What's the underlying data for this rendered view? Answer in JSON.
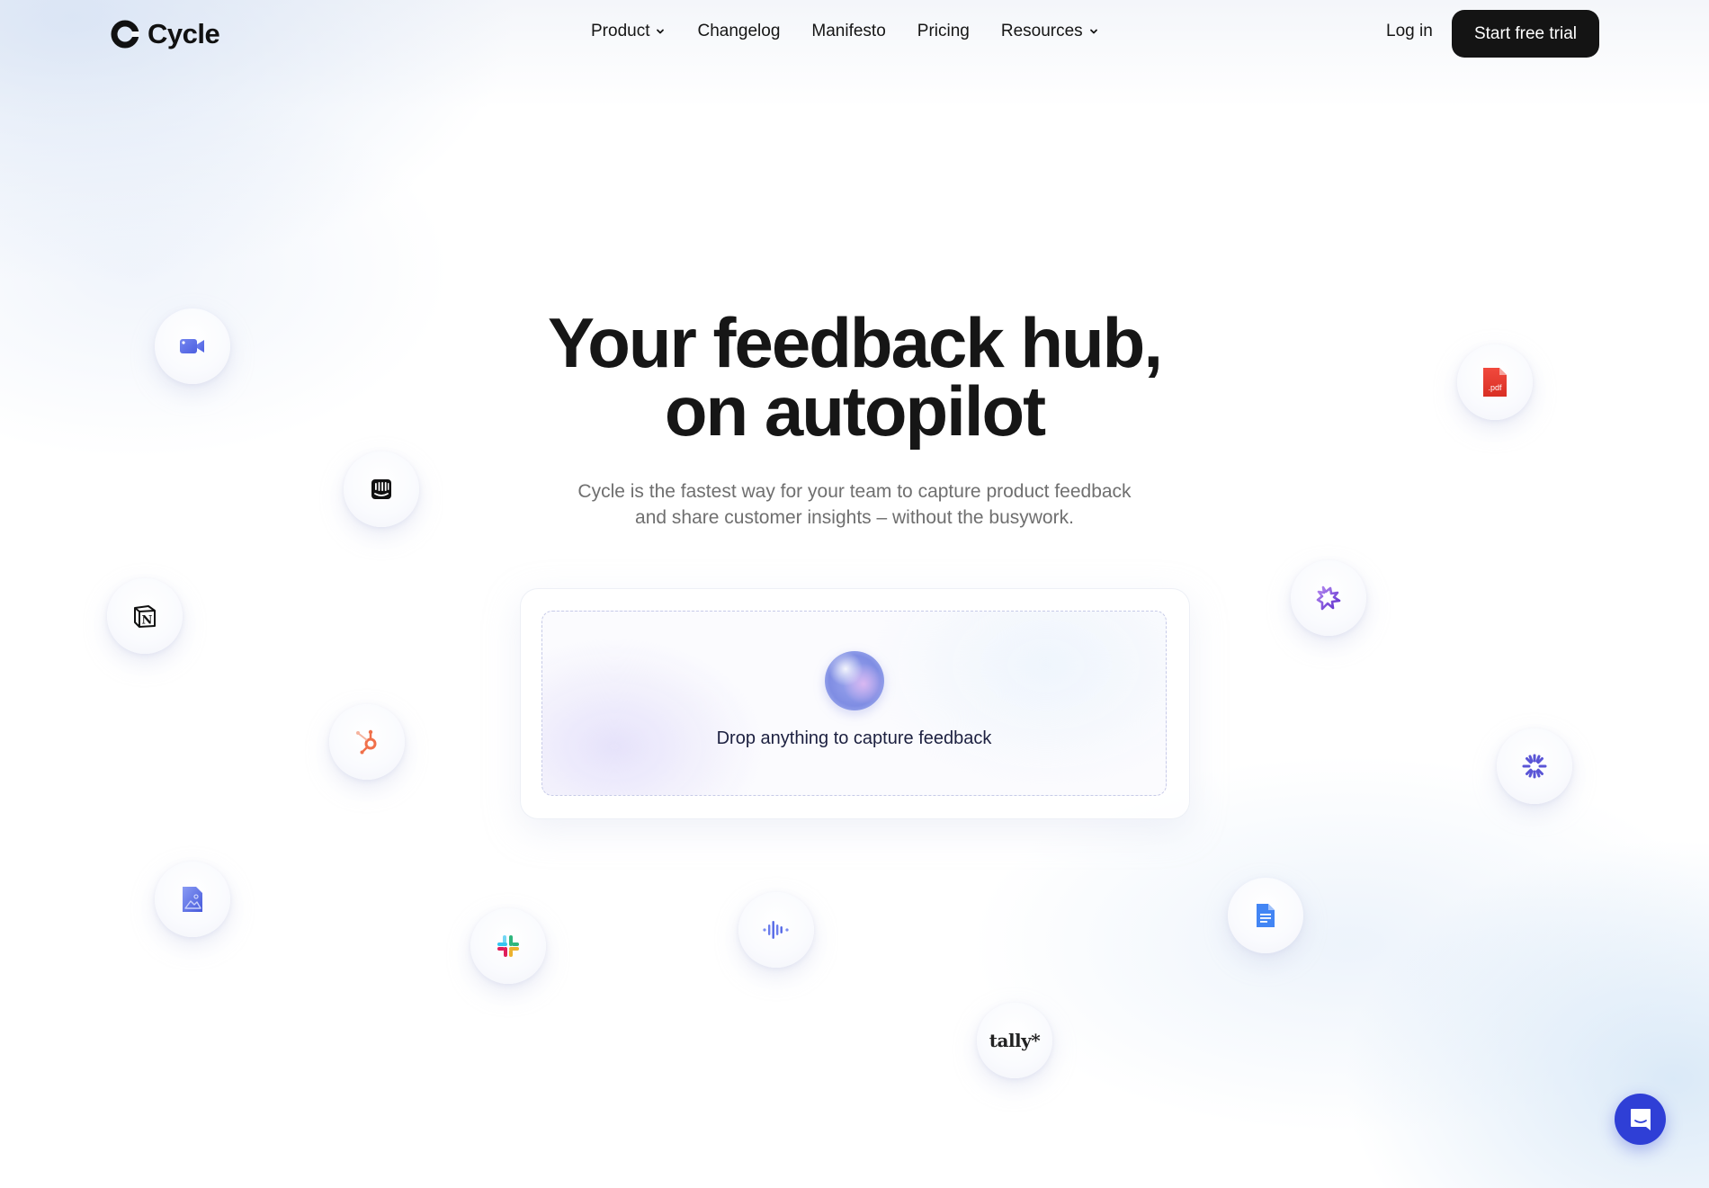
{
  "brand": {
    "name": "Cycle",
    "logo_icon": "cycle-logo-icon"
  },
  "nav": {
    "items": [
      {
        "label": "Product",
        "has_dropdown": true
      },
      {
        "label": "Changelog",
        "has_dropdown": false
      },
      {
        "label": "Manifesto",
        "has_dropdown": false
      },
      {
        "label": "Pricing",
        "has_dropdown": false
      },
      {
        "label": "Resources",
        "has_dropdown": true
      }
    ],
    "login_label": "Log in",
    "cta_label": "Start free trial"
  },
  "hero": {
    "title_line1": "Your feedback hub,",
    "title_line2": "on autopilot",
    "subtitle_line1": "Cycle is the fastest way for your team to capture product feedback",
    "subtitle_line2": "and share customer insights – without the busywork."
  },
  "dropzone": {
    "label": "Drop anything to capture feedback",
    "icon": "orb-icon"
  },
  "integrations": [
    {
      "name": "video-camera",
      "icon": "video-camera-icon",
      "color": "#5b6ee8"
    },
    {
      "name": "intercom",
      "icon": "intercom-icon",
      "color": "#111111"
    },
    {
      "name": "notion",
      "icon": "notion-icon",
      "color": "#111111"
    },
    {
      "name": "hubspot",
      "icon": "hubspot-icon",
      "color": "#f0704a"
    },
    {
      "name": "image-file",
      "icon": "image-file-icon",
      "color": "#4d63e0"
    },
    {
      "name": "slack",
      "icon": "slack-icon",
      "color": "#e01e5a"
    },
    {
      "name": "audio",
      "icon": "audio-waveform-icon",
      "color": "#5b6ee8"
    },
    {
      "name": "tally",
      "icon": "tally-logo",
      "label": "tally*",
      "color": "#222222"
    },
    {
      "name": "google-docs",
      "icon": "google-docs-icon",
      "color": "#4285f4"
    },
    {
      "name": "loader",
      "icon": "starburst-icon",
      "color": "#5a55d6"
    },
    {
      "name": "gong",
      "icon": "gong-icon",
      "color": "#7a3fd6"
    },
    {
      "name": "pdf",
      "icon": "pdf-file-icon",
      "label": ".pdf",
      "color": "#e8392e"
    }
  ],
  "chat_launcher": {
    "icon": "chat-bubble-icon",
    "color": "#2f3fd6"
  }
}
